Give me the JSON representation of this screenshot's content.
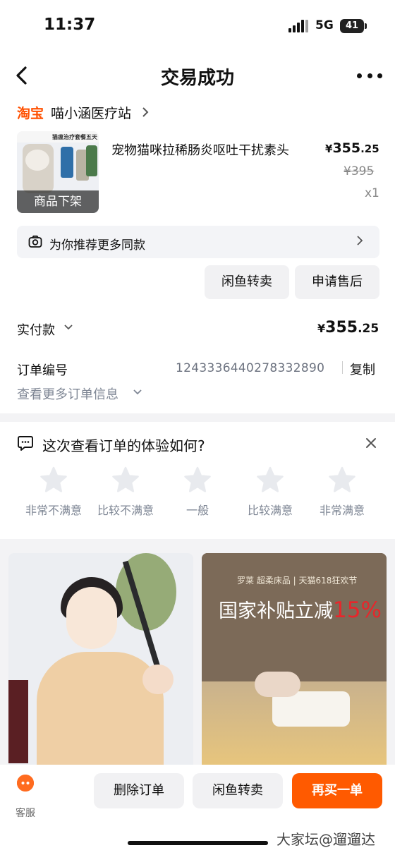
{
  "status": {
    "time": "11:37",
    "network": "5G",
    "battery": "41"
  },
  "header": {
    "title": "交易成功"
  },
  "shop": {
    "platform": "淘宝",
    "name": "喵小涵医疗站"
  },
  "product": {
    "thumb_title": "猫瘟治疗套餐五天",
    "thumb_overlay": "商品下架",
    "name": "宠物猫咪拉稀肠炎呕吐干扰素头",
    "currency": "¥",
    "price_int": "355",
    "price_dec": ".25",
    "original_price": "¥395",
    "quantity": "x1"
  },
  "recommend": {
    "label": "为你推荐更多同款"
  },
  "actions": {
    "xianyu": "闲鱼转卖",
    "after_sale": "申请售后"
  },
  "payment": {
    "label": "实付款",
    "currency": "¥",
    "int": "355",
    "dec": ".25"
  },
  "order": {
    "number_label": "订单编号",
    "number": "1243336440278332890",
    "copy": "复制",
    "more": "查看更多订单信息"
  },
  "survey": {
    "question": "这次查看订单的体验如何?",
    "ratings": [
      "非常不满意",
      "比较不满意",
      "一般",
      "比较满意",
      "非常满意"
    ]
  },
  "feed": {
    "ad": {
      "brand": "罗莱 超柔床品 | 天猫618狂欢节",
      "headline": "国家补贴立减",
      "percent": "15%"
    }
  },
  "bottom_bar": {
    "service": "客服",
    "delete": "删除订单",
    "xianyu": "闲鱼转卖",
    "rebuy": "再买一单"
  },
  "watermark": "大家坛@遛遛达",
  "colors": {
    "accent": "#ff5000",
    "buy_button": "#ff5a00",
    "muted_text": "#7e8694"
  }
}
